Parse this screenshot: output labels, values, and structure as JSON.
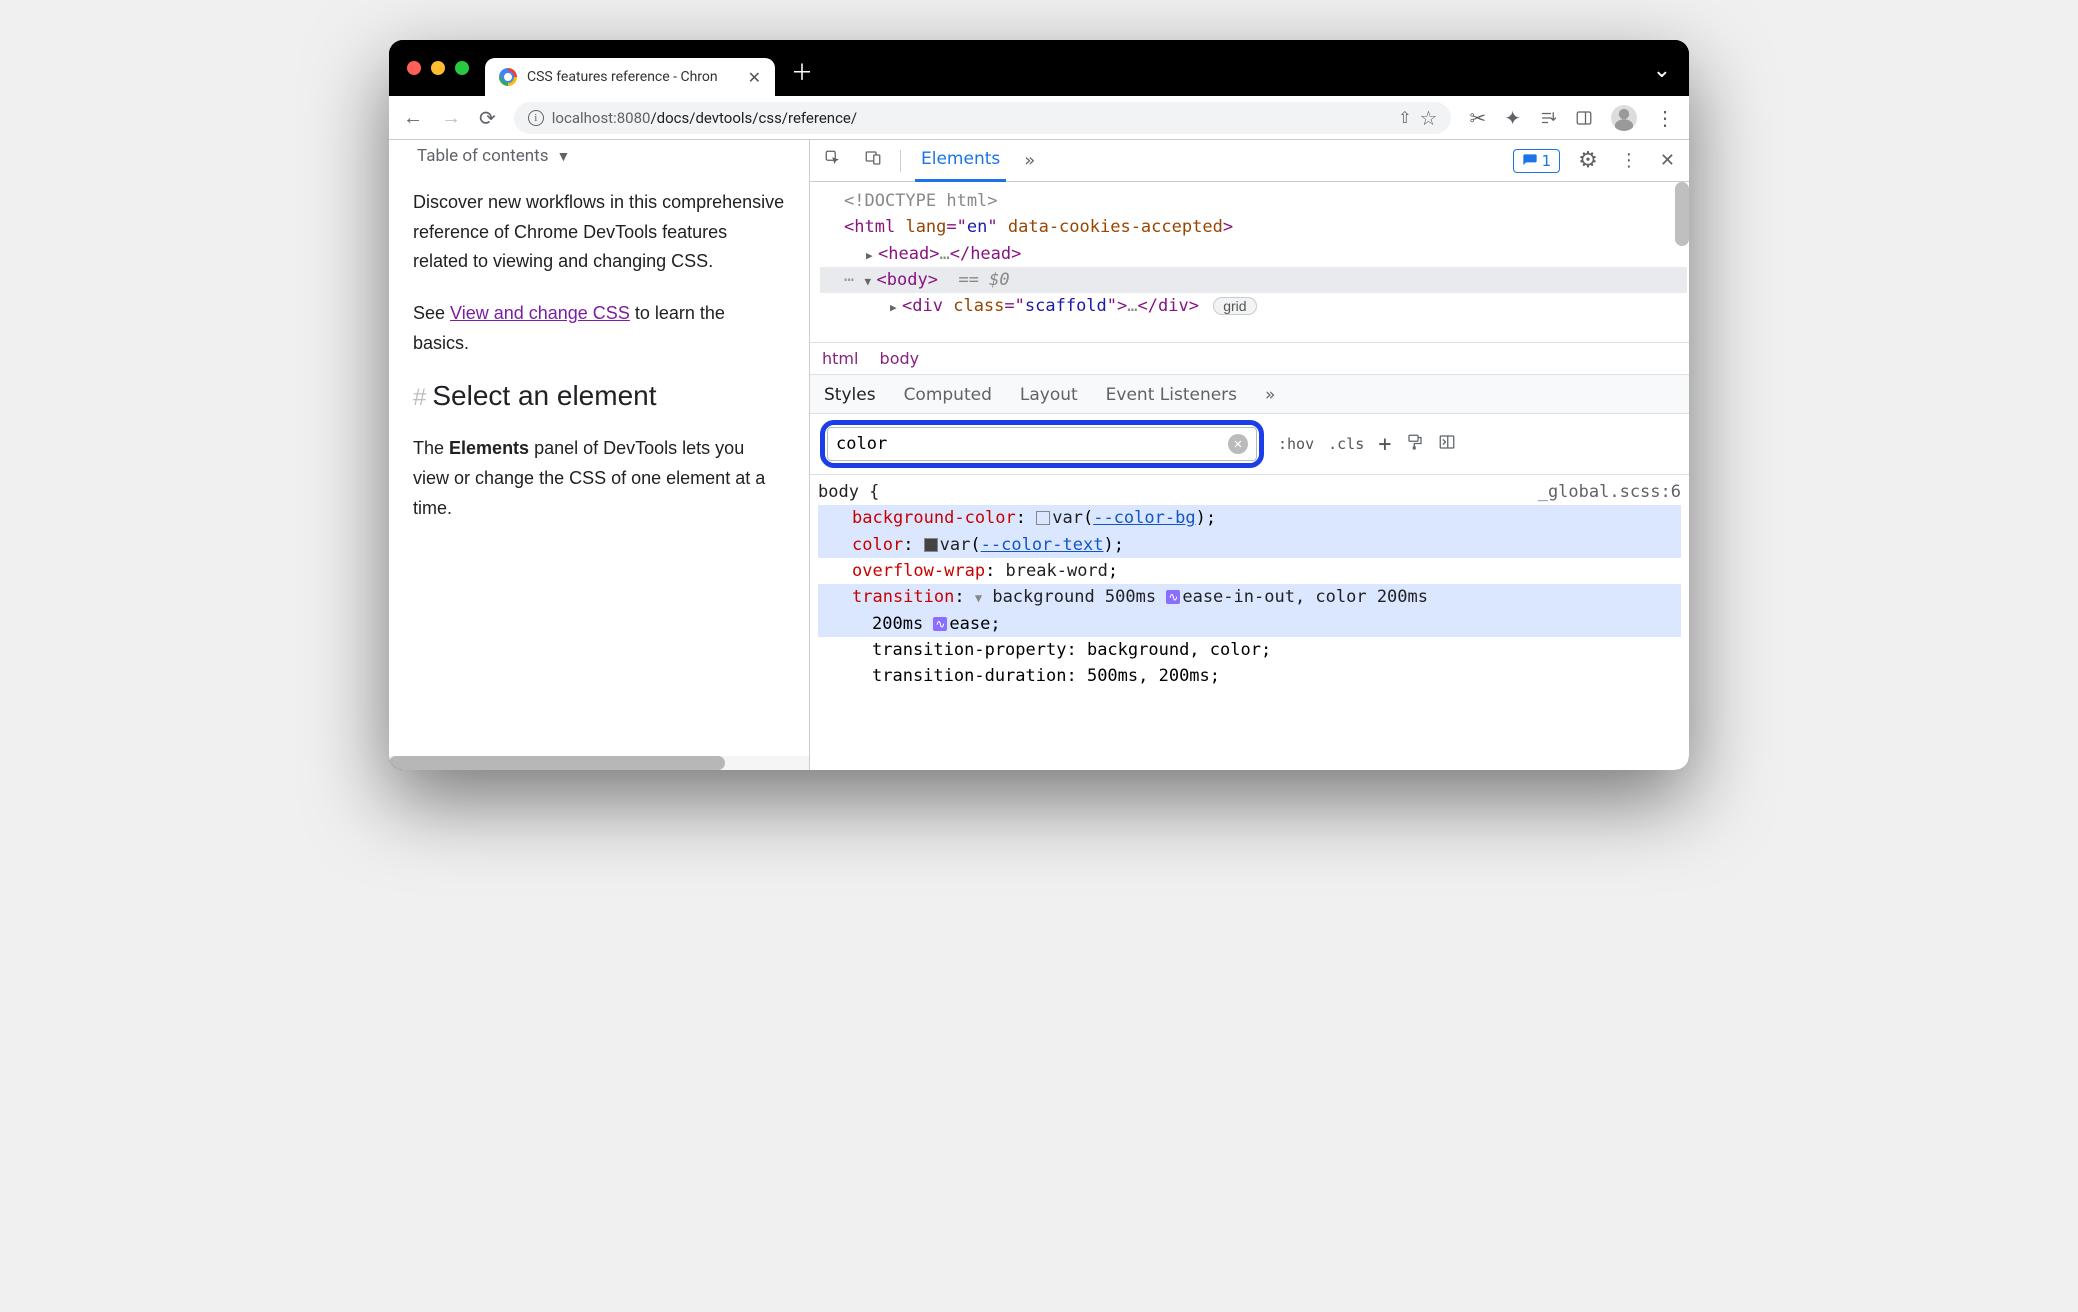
{
  "browser": {
    "tab_title": "CSS features reference - Chron",
    "url_host": "localhost",
    "url_port": ":8080",
    "url_path": "/docs/devtools/css/reference/"
  },
  "page": {
    "toc_label": "Table of contents",
    "para1": "Discover new workflows in this comprehensive reference of Chrome DevTools features related to viewing and changing CSS.",
    "para2_pre": "See ",
    "para2_link": "View and change CSS",
    "para2_post": " to learn the basics.",
    "h2": "Select an element",
    "para3_pre": "The ",
    "para3_bold": "Elements",
    "para3_post": " panel of DevTools lets you view or change the CSS of one element at a time."
  },
  "devtools": {
    "tabs": {
      "elements": "Elements"
    },
    "issues_count": "1",
    "dom": {
      "doctype": "<!DOCTYPE html>",
      "html_open": "html",
      "html_attr1_name": "lang",
      "html_attr1_val": "en",
      "html_attr2_name": "data-cookies-accepted",
      "head": "head",
      "body": "body",
      "body_eq": "== $0",
      "div": "div",
      "div_attr_name": "class",
      "div_attr_val": "scaffold",
      "grid_badge": "grid"
    },
    "crumbs": {
      "html": "html",
      "body": "body"
    },
    "pane_tabs": {
      "styles": "Styles",
      "computed": "Computed",
      "layout": "Layout",
      "event": "Event Listeners"
    },
    "filter_value": "color",
    "hov": ":hov",
    "cls": ".cls",
    "rule": {
      "selector": "body {",
      "src": "_global.scss:6",
      "r1": {
        "prop": "background-color",
        "func": "var",
        "var": "--color-bg"
      },
      "r2": {
        "prop": "color",
        "func": "var",
        "var": "--color-text"
      },
      "r3": {
        "prop": "overflow-wrap",
        "val": "break-word"
      },
      "r4": {
        "prop": "transition",
        "v1": "background 500ms",
        "b1": "ease-in-out",
        "v2": ", color 200ms",
        "b2": "ease"
      },
      "r5": {
        "prop": "transition-property",
        "val": "background, color"
      },
      "r6": {
        "prop": "transition-duration",
        "val": "500ms, 200ms"
      }
    }
  }
}
